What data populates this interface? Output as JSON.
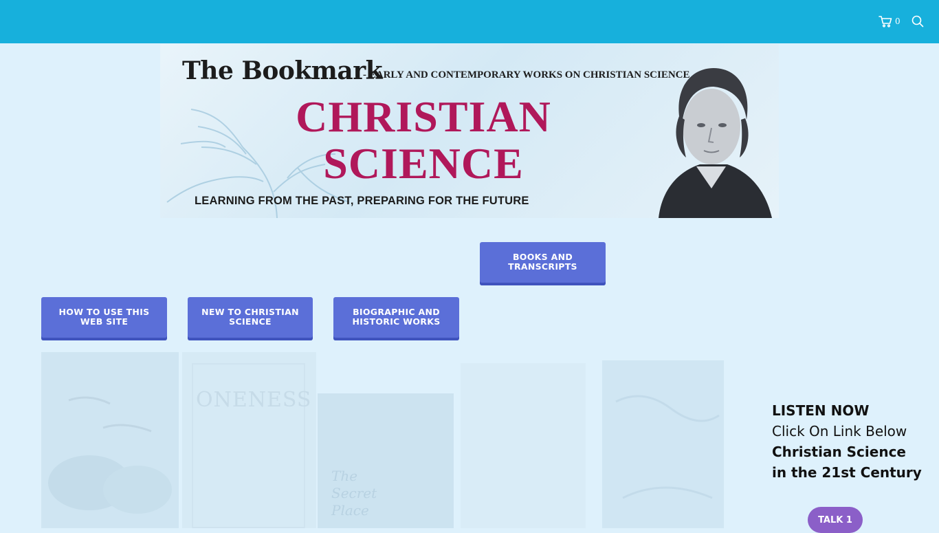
{
  "header": {
    "cart_count": "0",
    "icons": {
      "cart": "shopping-cart-icon",
      "search": "search-icon"
    },
    "background_color": "#17b0dc"
  },
  "banner": {
    "title": "The Bookmark",
    "subtitle": "- EARLY AND CONTEMPORARY WORKS ON CHRISTIAN SCIENCE",
    "headline_line1": "CHRISTIAN",
    "headline_line2": "SCIENCE",
    "tagline": "LEARNING FROM THE PAST, PREPARING FOR THE FUTURE",
    "headline_color": "#b0185a"
  },
  "nav_buttons": {
    "books": "BOOKS AND TRANSCRIPTS",
    "how_to_use": "HOW TO USE THIS WEB SITE",
    "new_to_cs": "NEW TO CHRISTIAN SCIENCE",
    "biographic": "BIOGRAPHIC AND HISTORIC WORKS",
    "button_color": "#5b6fd8"
  },
  "covers": {
    "oneness_title": "ONENESS",
    "secret_place_line1": "The",
    "secret_place_line2": "Secret",
    "secret_place_line3": "Place"
  },
  "listen": {
    "line1": "LISTEN NOW",
    "line2": "Click On Link Below",
    "line3": "Christian Science",
    "line4": "in the 21st Century",
    "talk_button": "TALK 1",
    "talk_color": "#8b5fc8"
  },
  "page": {
    "background_color": "#def1fc"
  }
}
